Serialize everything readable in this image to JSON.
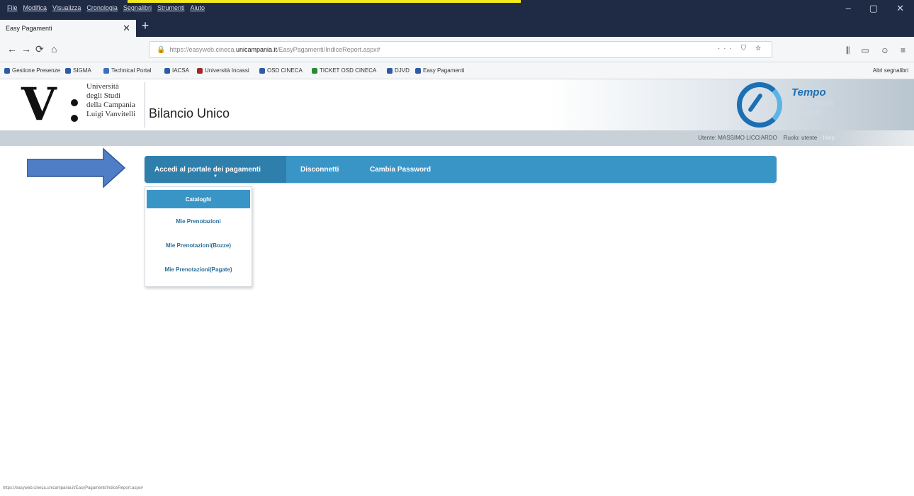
{
  "browser": {
    "menus": [
      "File",
      "Modifica",
      "Visualizza",
      "Cronologia",
      "Segnalibri",
      "Strumenti",
      "Aiuto"
    ],
    "window_controls": [
      "–",
      "▢",
      "✕"
    ],
    "tab_title": "Easy Pagamenti",
    "tab_close": "✕",
    "new_tab": "+",
    "nav": {
      "back": "←",
      "forward": "→",
      "reload": "⟳",
      "home": "⌂"
    },
    "url_prefix": "https://easyweb.cineca.",
    "url_domain": "unicampania.it",
    "url_path": "/EasyPagamenti/IndiceReport.aspx#",
    "url_actions": "··· ⛉ ☆",
    "right_buttons": [
      "⫼",
      "▭",
      "☺",
      "≡"
    ],
    "bookmarks": [
      {
        "label": "Gestione Presenze",
        "color": "#2e5aa8"
      },
      {
        "label": "SIGMA",
        "color": "#2e5aa8"
      },
      {
        "label": "Technical Portal",
        "color": "#3a6fc2"
      },
      {
        "label": "IACSA",
        "color": "#2e5aa8"
      },
      {
        "label": "Università Incassi",
        "color": "#9e2a2a"
      },
      {
        "label": "OSD CINECA",
        "color": "#2e5aa8"
      },
      {
        "label": "TICKET OSD CINECA",
        "color": "#2a8a3a"
      },
      {
        "label": "DJVD",
        "color": "#2e5aa8"
      },
      {
        "label": "Easy Pagamenti",
        "color": "#2e5aa8"
      }
    ],
    "bookmarks_other": "Altri segnalibri",
    "status_url": "https://easyweb.cineca.unicampania.it/EasyPagamenti/IndiceReport.aspx#"
  },
  "header": {
    "logo_letter": "V",
    "university_lines": [
      "Università",
      "degli Studi",
      "della Campania",
      "Luigi Vanvitelli"
    ],
    "app_title": "Bilancio Unico",
    "brand_title": "Tempo",
    "brand_sub": [
      "Innovation",
      "Source"
    ]
  },
  "userbar": {
    "user_label": "Utente: MASSIMO LICCIARDO",
    "role_label": "Ruolo: utente",
    "help_label": "Help"
  },
  "menu": {
    "items": [
      "Accedi al portale dei pagamenti",
      "Disconnetti",
      "Cambia Password"
    ],
    "caret": "▼"
  },
  "dropdown": {
    "items": [
      "Cataloghi",
      "Mie Prenotazioni",
      "Mie Prenotazioni(Bozze)",
      "Mie Prenotazioni(Pagate)"
    ]
  },
  "colors": {
    "menu_bg": "#3a95c7",
    "menu_active": "#2f7fad",
    "arrow": "#4f7ec6",
    "chrome_dark": "#1f2a44"
  }
}
